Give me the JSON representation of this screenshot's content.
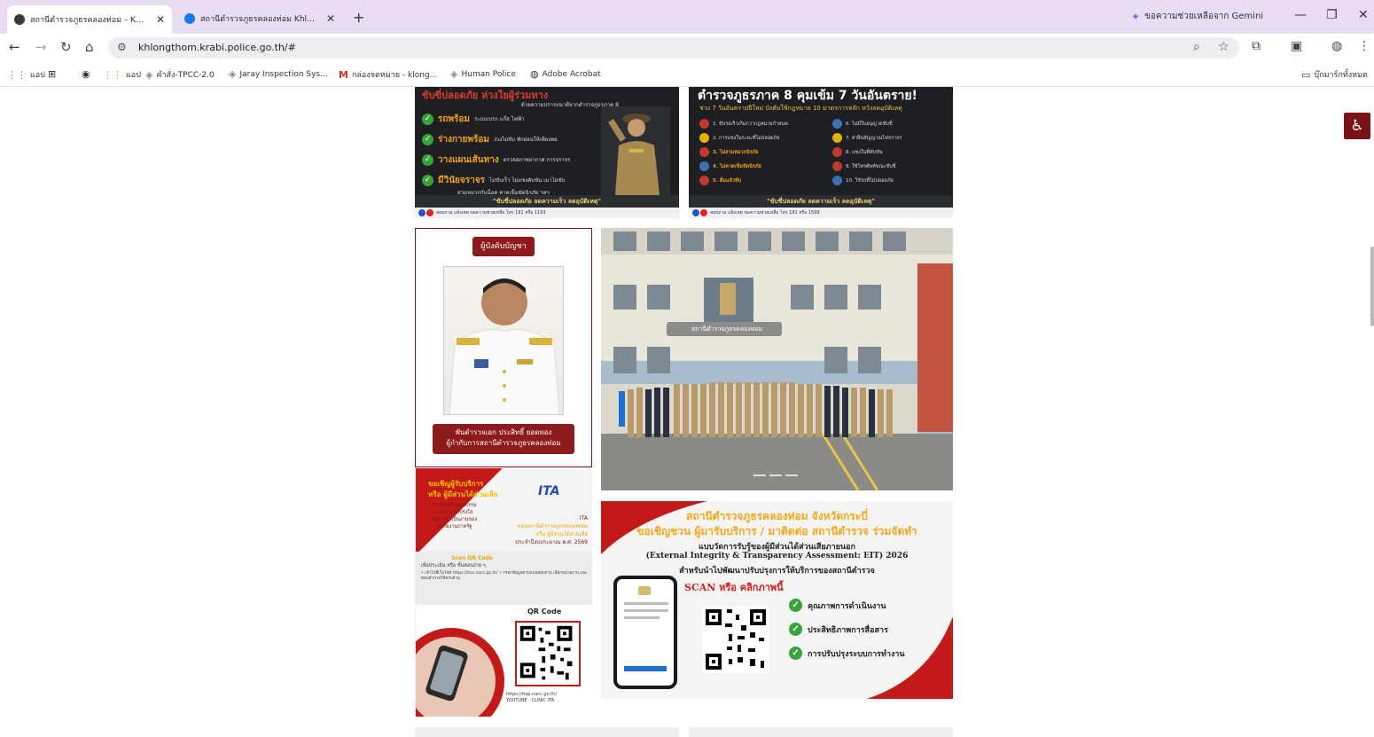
{
  "browser": {
    "tabs": [
      {
        "title": "สถานีตำรวจภูธรคลองท่อม – Khlong",
        "active": true
      },
      {
        "title": "สถานีตำรวจภูธรคลองท่อม Khlongt",
        "active": false
      }
    ],
    "gemini_label": "ขอความช่วยเหลือจาก Gemini",
    "url": "khlongthom.krabi.police.go.th/#",
    "bookmarks": [
      "แอป",
      "แอป",
      "คำสั่ง-TPCC-2.0",
      "Jaray Inspection Sys...",
      "กล่องจดหมาย - klong...",
      "Human Police",
      "Adobe Acrobat"
    ],
    "all_bookmarks": "บุ๊กมาร์กทั้งหมด"
  },
  "banner_left": {
    "title": "ขับขี่ปลอดภัย ห่วงใยผู้ร่วมทาง",
    "subtitle": "ด้วยความปรารถนาดีจากตำรวจภูธรภาค 8",
    "items": [
      {
        "big": "รถพร้อม",
        "small": "ระบบเบรก แก๊ส ไฟฟ้า"
      },
      {
        "big": "ร่างกายพร้อม",
        "small": "ง่วงไม่ขับ พักผ่อนให้เพียงพอ"
      },
      {
        "big": "วางแผนเส้นทาง",
        "small": "ตรวจสภาพอากาศ การจราจร"
      },
      {
        "big": "มีวินัยจราจร",
        "small": "ไม่ขับเร็ว ไม่แซงคับขัน เมาไม่ขับ"
      }
    ],
    "items_extra": "สวมหมวกกันน็อค คาดเข็มขัดนิรภัย ฯลฯ",
    "slogan": "\"ขับขี่ปลอดภัย ลดความเร็ว ลดอุบัติเหตุ\"",
    "footer": "สอบถาม แจ้งเหตุ ขอความช่วยเหลือ โทร 191 หรือ 1193"
  },
  "banner_right": {
    "title": "ตำรวจภูธรภาค 8 คุมเข้ม 7 วันอันตราย!",
    "subtitle": "ช่วง 7 วันอันตรายปีใหม่ บังคับใช้กฎหมาย 10 มาตรการหลัก หวังลดอุบัติเหตุ",
    "rules": [
      "1. ขับรถเร็วเกินกว่ากฎหมายกำหนด",
      "2. การแซงในระยะที่ไม่ปลอดภัย",
      "3. ไม่สวมหมวกนิรภัย",
      "4. ไม่คาดเข็มขัดนิรภัย",
      "5. ดื่มแล้วขับ",
      "6. ไม่มีใบอนุญาตขับขี่",
      "7. ฝ่าฝืนสัญญาณไฟจราจร",
      "8. แซงในที่คับขัน",
      "9. ใช้โทรศัพท์ขณะขับขี่",
      "10. ใช้รถที่ไม่ปลอดภัย"
    ],
    "slogan": "\"ขับขี่ปลอดภัย ลดความเร็ว ลดอุบัติเหตุ\"",
    "footer": "สอบถาม แจ้งเหตุ ขอความช่วยเหลือ โทร 191 หรือ 1599"
  },
  "profile": {
    "heading": "ผู้บังคับบัญชา",
    "name": "พันตำรวจเอก ประสิทธิ์ ยอดทอง",
    "position": "ผู้กำกับการสถานีตำรวจภูธรคลองท่อม"
  },
  "carousel": {
    "building_sign": "สถานีตำรวจภูธรคลองท่อม",
    "dots": 3
  },
  "ita_poster": {
    "invite_line1": "ขอเชิญผู้รับบริการ",
    "invite_line2": "หรือ ผู้มีส่วนได้ส่วนเสีย",
    "logo": "ITA",
    "left_lines": [
      "ร่วมประเมินคุณธรรม",
      "และความโปร่งใส",
      "ในการดำเนินงานของ",
      "หน่วยงานภาครัฐ"
    ],
    "right_lines": [
      "ITA",
      "ของสถานีตำรวจภูธรคลองท่อม",
      "หรือ ผู้มีส่วนได้ส่วนเสีย",
      "ประจำปีงบประมาณ พ.ศ. 2569"
    ],
    "scan_title": "Scan QR Code",
    "scan_sub": "เพื่อประเมิน หรือ ขั้นตอนง่าย ๆ",
    "bullets": "• เข้าไปที่เว็บไซต์ https://itas.nacc.go.th/ • กรอกข้อมูลตามแบบสอบถาม เลือกหน่วยงาน และตอบคำถามให้ครบถ้วน",
    "qr_label": "QR Code",
    "url": "https://itap.nacc.go.th/",
    "youtube": "YOUTUBE : CLINIC ITA"
  },
  "eit_poster": {
    "line1": "สถานีตำรวจภูธรคลองท่อม จังหวัดกระบี่",
    "line2": "ขอเชิญชวน ผู้มารับบริการ / มาติดต่อ สถานีตำรวจ ร่วมจัดทำ",
    "line3": "แบบวัดการรับรู้ของผู้มีส่วนได้ส่วนเสียภายนอก",
    "line4": "(External Integrity & Transparency Assessment: EIT) 2026",
    "line5": "สำหรับนำไปพัฒนาปรับปรุงการให้บริการของสถานีตำรวจ",
    "scan": "SCAN หรือ คลิกภาพนี้",
    "items": [
      "คุณภาพการดำเนินงาน",
      "ประสิทธิภาพการสื่อสาร",
      "การปรับปรุงระบบการทำงาน"
    ]
  },
  "colors": {
    "brand_red": "#8d1a1a",
    "tab_strip": "#e9ddf3",
    "ok_green": "#3aa23a",
    "gold": "#f0a81a"
  },
  "icons": [
    "back-icon",
    "forward-icon",
    "reload-icon",
    "home-icon",
    "site-info-icon",
    "zoom-icon",
    "star-icon",
    "extensions-icon",
    "accessibility-icon"
  ]
}
